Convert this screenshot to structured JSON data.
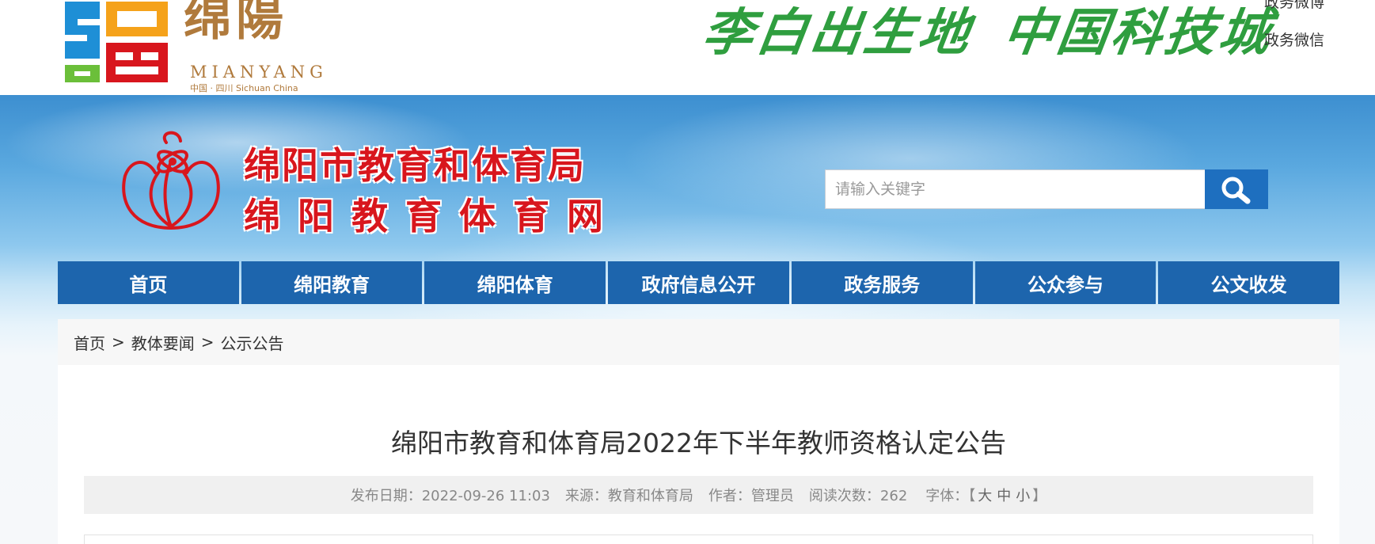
{
  "header": {
    "city_logo": {
      "name_cn": "绵陽",
      "name_en": "MIANYANG",
      "subline": "中国 · 四川 Sichuan China",
      "colors": {
        "blue": "#1e8fd6",
        "orange": "#f5a21a",
        "green": "#6bbf3a",
        "red": "#d8161d",
        "brown": "#b07a3c"
      }
    },
    "slogan_part1": "李白出生地",
    "slogan_part2": "中国科技城",
    "slogan_color": "#2f9e3f",
    "links": [
      {
        "label": "政务微博"
      },
      {
        "label": "政务微信"
      }
    ]
  },
  "site": {
    "title_line1": "绵阳市教育和体育局",
    "title_line2": "绵阳教育体育网",
    "title_color": "#d8161d",
    "emblem_icon": "lotus-atom-emblem-icon"
  },
  "search": {
    "placeholder": "请输入关键字",
    "value": "",
    "button_icon": "search-icon",
    "button_color": "#1e6fbf"
  },
  "nav": {
    "color": "#1d65ad",
    "items": [
      {
        "label": "首页"
      },
      {
        "label": "绵阳教育"
      },
      {
        "label": "绵阳体育"
      },
      {
        "label": "政府信息公开"
      },
      {
        "label": "政务服务"
      },
      {
        "label": "公众参与"
      },
      {
        "label": "公文收发"
      }
    ]
  },
  "breadcrumb": {
    "items": [
      "首页",
      "教体要闻",
      "公示公告"
    ],
    "separator": ">"
  },
  "article": {
    "title": "绵阳市教育和体育局2022年下半年教师资格认定公告",
    "meta": {
      "date_label": "发布日期：",
      "date": "2022-09-26 11:03",
      "source_label": "来源：",
      "source": "教育和体育局",
      "author_label": "作者：",
      "author": "管理员",
      "views_label": "阅读次数：",
      "views": "262",
      "font_label": "字体：",
      "font_open": "【",
      "font_large": "大",
      "font_medium": "中",
      "font_small": "小",
      "font_close": "】"
    }
  }
}
